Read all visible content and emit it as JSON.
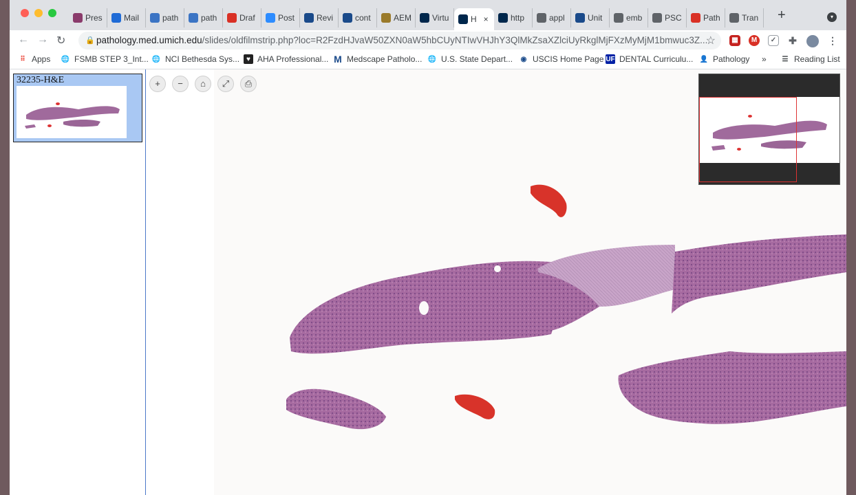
{
  "browser": {
    "tabs": [
      {
        "label": "Pres",
        "icon": "slides-icon",
        "color": "#8a3b6b"
      },
      {
        "label": "Mail",
        "icon": "outlook-icon",
        "color": "#1f6bd6"
      },
      {
        "label": "path",
        "icon": "slide-viewer-icon",
        "color": "#3b74c4"
      },
      {
        "label": "path",
        "icon": "slide-viewer-icon",
        "color": "#3b74c4"
      },
      {
        "label": "Draf",
        "icon": "gmail-icon",
        "color": "#d93025"
      },
      {
        "label": "Post",
        "icon": "zoom-icon",
        "color": "#2d8cff"
      },
      {
        "label": "Revi",
        "icon": "journal-icon",
        "color": "#1a4a8a"
      },
      {
        "label": "cont",
        "icon": "journal-icon",
        "color": "#1a4a8a"
      },
      {
        "label": "AEM",
        "icon": "folder-icon",
        "color": "#9a7a2a"
      },
      {
        "label": "Virtu",
        "icon": "umich-icon",
        "color": "#00274c"
      },
      {
        "label": "H",
        "icon": "umich-icon",
        "color": "#00274c",
        "active": true
      },
      {
        "label": "http",
        "icon": "umich-icon",
        "color": "#00274c"
      },
      {
        "label": "appl",
        "icon": "google-icon",
        "color": "#5f6368"
      },
      {
        "label": "Unit",
        "icon": "journal-icon",
        "color": "#1a4a8a"
      },
      {
        "label": "emb",
        "icon": "google-icon",
        "color": "#5f6368"
      },
      {
        "label": "PSC",
        "icon": "google-icon",
        "color": "#5f6368"
      },
      {
        "label": "Path",
        "icon": "pathology-icon",
        "color": "#d93025"
      },
      {
        "label": "Tran",
        "icon": "globe-icon",
        "color": "#5f6368"
      }
    ],
    "url_host": "pathology.med.umich.edu",
    "url_path": "/slides/oldfilmstrip.php?loc=R2FzdHJvaW50ZXN0aW5hbCUyNTIwVHJhY3QlMkZsaXZlciUyRkglMjFXzMyMjM1bmwuc3Z...",
    "bookmarks": [
      {
        "label": "Apps",
        "icon": "apps-grid-icon"
      },
      {
        "label": "FSMB STEP 3_Int...",
        "icon": "globe-icon"
      },
      {
        "label": "NCI Bethesda Sys...",
        "icon": "globe-icon"
      },
      {
        "label": "AHA Professional...",
        "icon": "aha-icon"
      },
      {
        "label": "Medscape Patholo...",
        "icon": "medscape-icon"
      },
      {
        "label": "U.S. State Depart...",
        "icon": "globe-icon"
      },
      {
        "label": "USCIS Home Page",
        "icon": "uscis-icon"
      },
      {
        "label": "DENTAL Curriculu...",
        "icon": "uf-icon"
      },
      {
        "label": "Pathology",
        "icon": "person-icon"
      }
    ],
    "overflow": "»",
    "reading_list": "Reading List"
  },
  "viewer": {
    "strip_label": "32235-H&E",
    "zoom_buttons": [
      "+",
      "−",
      "⌂",
      "⤢",
      "⎙"
    ]
  }
}
